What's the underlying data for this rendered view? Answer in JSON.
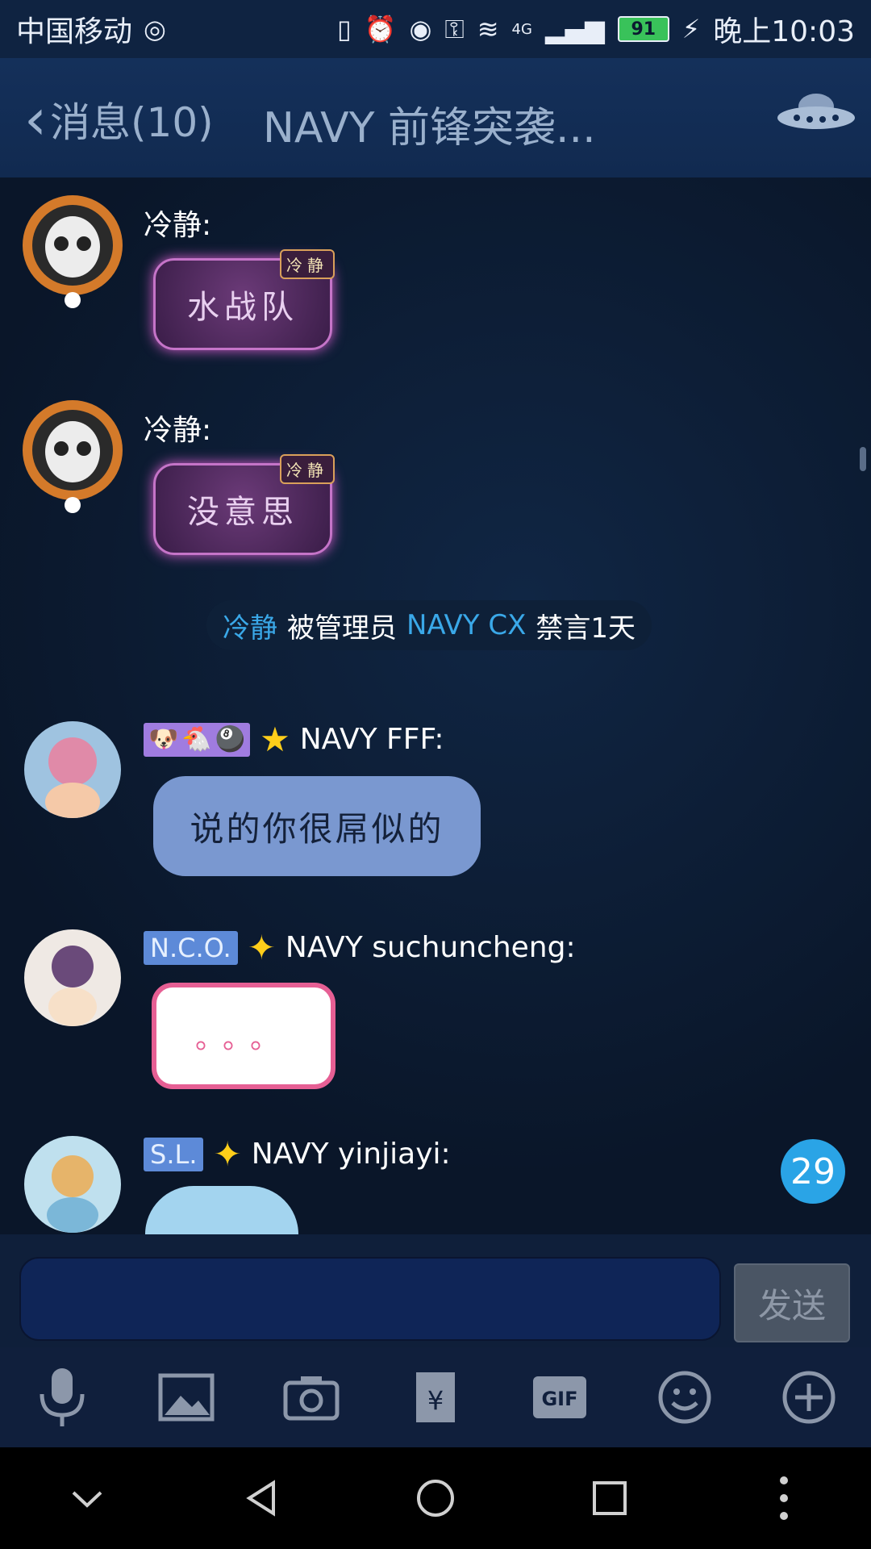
{
  "status_bar": {
    "carrier": "中国移动",
    "network": "4G",
    "battery": "91",
    "time": "晚上10:03"
  },
  "header": {
    "back_label": "消息(10)",
    "title": "NAVY 前锋突袭..."
  },
  "messages": [
    {
      "sender": "冷静:",
      "text": "水战队",
      "badge": "冷静"
    },
    {
      "sender": "冷静:",
      "text": "没意思",
      "badge": "冷静"
    },
    {
      "sender": "NAVY FFF:",
      "text": "说的你很屌似的"
    },
    {
      "tag": "N.C.O.",
      "sender": "NAVY suchuncheng:",
      "text": "。。。"
    },
    {
      "tag": "S.L.",
      "sender": "NAVY yinjiayi:",
      "text": "……"
    }
  ],
  "system_notice": {
    "user": "冷静",
    "middle": "被管理员",
    "admin": "NAVY CX",
    "action": "禁言1天"
  },
  "unread_count": "29",
  "composer": {
    "send_label": "发送"
  },
  "toolbar": {
    "gif_label": "GIF"
  },
  "colors": {
    "background": "#0b1a30",
    "accent": "#3aa8e8",
    "header": "#112a50"
  }
}
